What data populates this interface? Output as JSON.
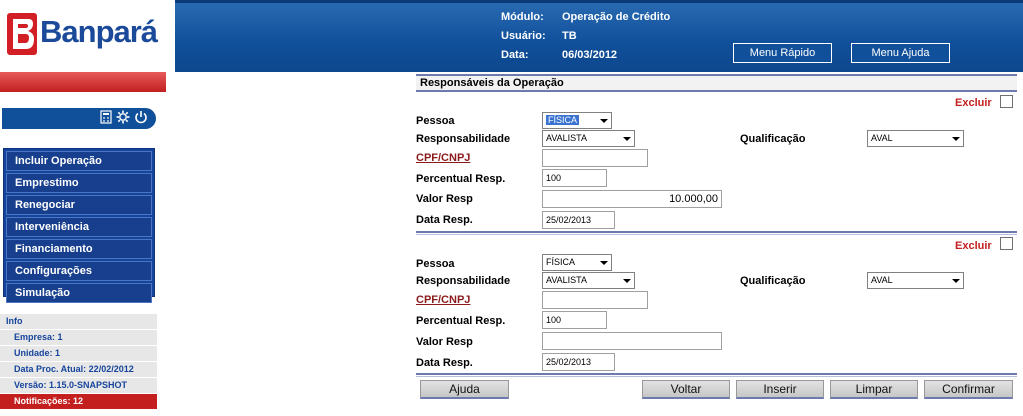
{
  "header": {
    "logo_text": "Banpará",
    "modulo_label": "Módulo:",
    "modulo_value": "Operação de Crédito",
    "usuario_label": "Usuário:",
    "usuario_value": "TB",
    "data_label": "Data:",
    "data_value": "06/03/2012",
    "menu_rapido": "Menu Rápido",
    "menu_ajuda": "Menu Ajuda"
  },
  "toolbar_icons": [
    "calculator-icon",
    "gear-icon",
    "power-icon"
  ],
  "menu": {
    "items": [
      "Incluir Operação",
      "Emprestimo",
      "Renegociar",
      "Interveniência",
      "Financiamento",
      "Configurações",
      "Simulação"
    ]
  },
  "info": {
    "title": "Info",
    "empresa": "Empresa: 1",
    "unidade": "Unidade: 1",
    "data_proc": "Data Proc. Atual: 22/02/2012",
    "versao": "Versão: 1.15.0-SNAPSHOT",
    "notificacoes": "Notificações: 12"
  },
  "section": {
    "title": "Responsáveis da Operação"
  },
  "labels": {
    "excluir": "Excluir",
    "pessoa": "Pessoa",
    "responsabilidade": "Responsabilidade",
    "qualificacao": "Qualificação",
    "cpf_cnpj": "CPF/CNPJ",
    "percentual": "Percentual Resp.",
    "valor": "Valor Resp",
    "data_resp": "Data Resp."
  },
  "responsaveis": [
    {
      "pessoa": "FÍSICA",
      "responsabilidade": "AVALISTA",
      "qualificacao": "AVAL",
      "cpf_cnpj": "",
      "percentual": "100",
      "valor": "10.000,00",
      "data": "25/02/2013"
    },
    {
      "pessoa": "FÍSICA",
      "responsabilidade": "AVALISTA",
      "qualificacao": "AVAL",
      "cpf_cnpj": "",
      "percentual": "100",
      "valor": "",
      "data": "25/02/2013"
    }
  ],
  "buttons": {
    "ajuda": "Ajuda",
    "voltar": "Voltar",
    "inserir": "Inserir",
    "limpar": "Limpar",
    "confirmar": "Confirmar"
  },
  "colors": {
    "header_blue": "#104f9a",
    "menu_blue": "#16449c",
    "accent_red": "#c41f1f"
  }
}
